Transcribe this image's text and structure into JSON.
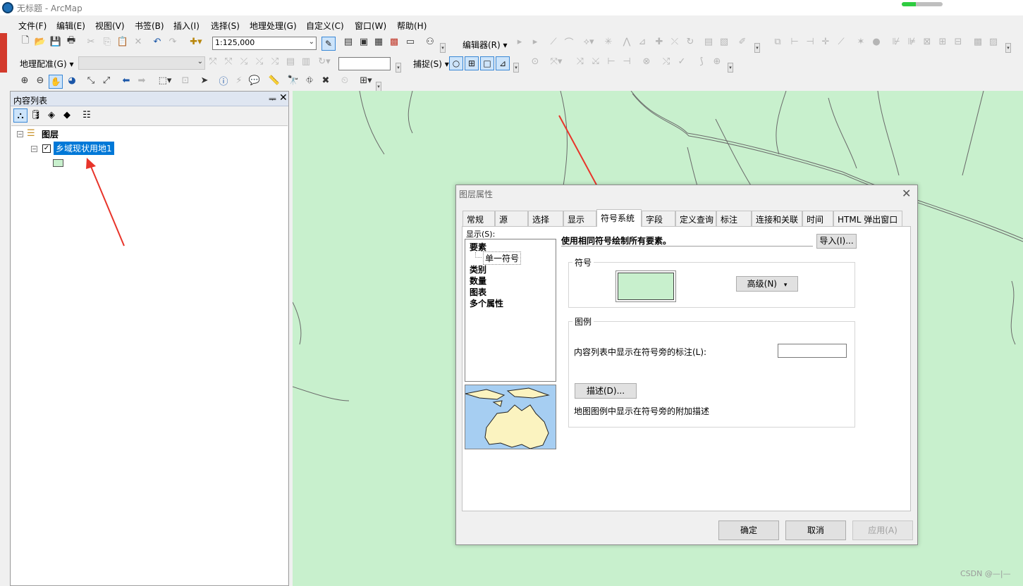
{
  "window": {
    "title": "无标题 - ArcMap",
    "progress": 0.35
  },
  "menu": [
    "文件(F)",
    "编辑(E)",
    "视图(V)",
    "书签(B)",
    "插入(I)",
    "选择(S)",
    "地理处理(G)",
    "自定义(C)",
    "窗口(W)",
    "帮助(H)"
  ],
  "toolbar": {
    "scale": "1:125,000",
    "editor_label": "编辑器(R)",
    "georef_label": "地理配准(G)",
    "snapping_label": "捕捉(S)"
  },
  "toc": {
    "title": "内容列表",
    "pin": "ᆕ",
    "close": "✕",
    "root_layer": "图层",
    "layer_name": "乡域现状用地1",
    "layer_checked": "✓",
    "expand_sign": "−",
    "legend_color": "#c8f0cd"
  },
  "map": {
    "fill_color": "#c8f0cd",
    "watermark": "CSDN @—|—"
  },
  "dialog": {
    "title": "图层属性",
    "close": "✕",
    "tabs": [
      "常规",
      "源",
      "选择",
      "显示",
      "符号系统",
      "字段",
      "定义查询",
      "标注",
      "连接和关联",
      "时间",
      "HTML 弹出窗口"
    ],
    "active_tab": "符号系统",
    "show_label": "显示(S):",
    "show_items": [
      "要素",
      "类别",
      "数量",
      "图表",
      "多个属性"
    ],
    "show_subitem": "单一符号",
    "heading": "使用相同符号绘制所有要素。",
    "import_button": "导入(I)...",
    "symbol_group": "符号",
    "advanced_button": "高级(N)",
    "legend_group": "图例",
    "legend_label": "内容列表中显示在符号旁的标注(L):",
    "legend_label_value": "",
    "description_button": "描述(D)...",
    "description_text": "地图图例中显示在符号旁的附加描述",
    "ok_button": "确定",
    "cancel_button": "取消",
    "apply_button": "应用(A)",
    "symbol_color": "#c8f0cd"
  }
}
